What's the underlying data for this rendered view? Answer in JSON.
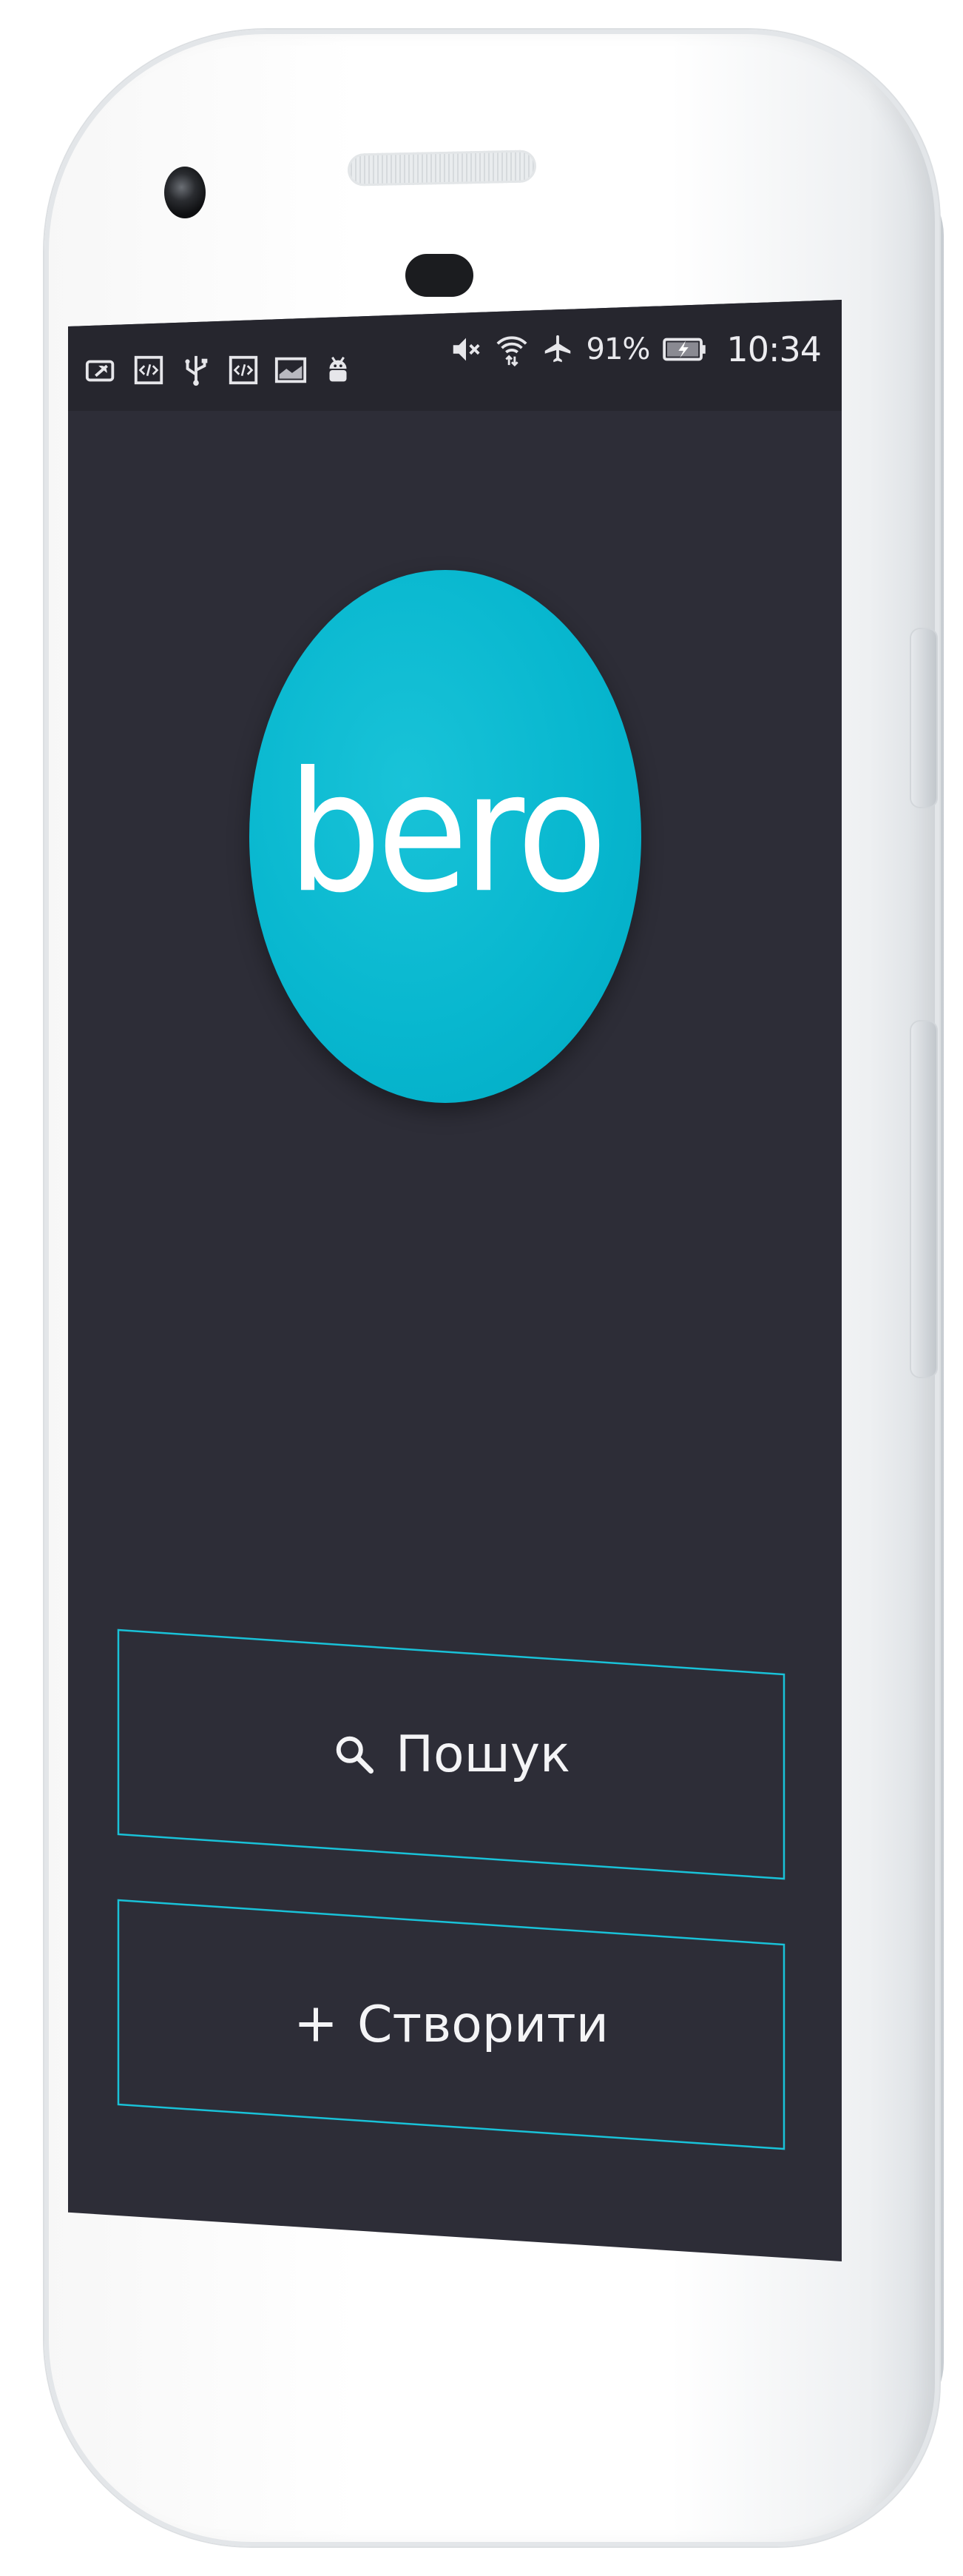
{
  "status_bar": {
    "left_icons": [
      "battery-saver-icon",
      "developer-code-icon",
      "usb-icon",
      "developer-code-icon",
      "screenshot-icon",
      "android-debug-icon"
    ],
    "right_icons": [
      "mute-icon",
      "wifi-icon",
      "airplane-mode-icon",
      "battery-charging-icon"
    ],
    "battery_percent": "91%",
    "time": "10:34"
  },
  "app": {
    "logo_text": "bero",
    "logo_color": "#00b4cd",
    "background_color": "#2d2d37",
    "accent_color": "#00bcd4"
  },
  "actions": {
    "search": {
      "label": "Пошук",
      "icon": "search-icon"
    },
    "create": {
      "label": "Створити",
      "icon": "plus-icon"
    }
  }
}
